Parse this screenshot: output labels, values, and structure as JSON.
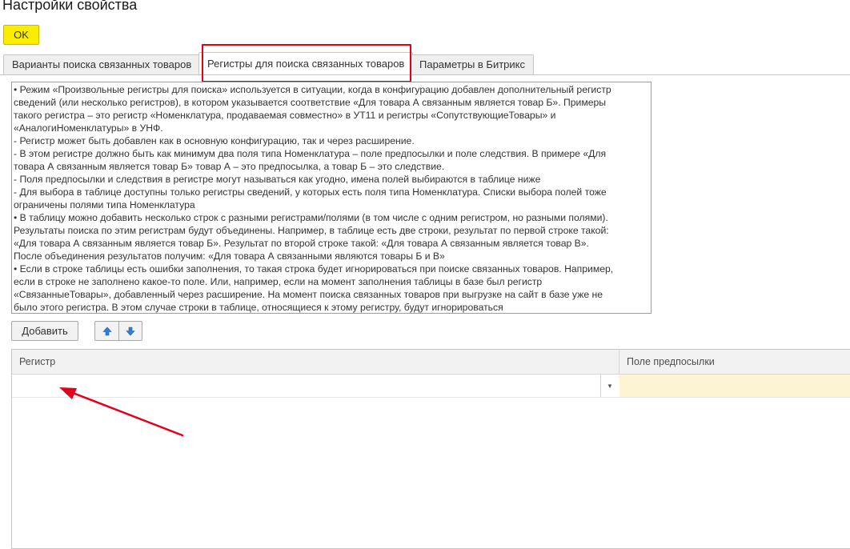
{
  "window": {
    "title": "Настройки свойства"
  },
  "toolbar": {
    "ok_label": "OK"
  },
  "tabs": [
    {
      "label": "Варианты поиска связанных товаров",
      "active": false
    },
    {
      "label": "Регистры для поиска связанных товаров",
      "active": true
    },
    {
      "label": "Параметры в Битрикс",
      "active": false
    }
  ],
  "info": {
    "lines": [
      "• Режим «Произвольные регистры для поиска» используется в ситуации, когда в конфигурацию добавлен дополнительный регистр",
      "сведений (или несколько регистров), в котором указывается соответствие «Для товара А связанным является товар Б». Примеры",
      "такого регистра – это регистр «Номенклатура, продаваемая совместно» в УТ11 и регистры «СопутствующиеТовары» и",
      "«АналогиНоменклатуры» в УНФ.",
      "- Регистр может быть добавлен как в основную конфигурацию, так и через расширение.",
      "- В этом регистре должно быть как минимум два поля типа Номенклатура – поле предпосылки и поле следствия. В примере «Для",
      "товара А связанным является товар Б» товар А – это предпосылка, а товар Б – это следствие.",
      "- Поля предпосылки и следствия в регистре могут называться как угодно, имена полей выбираются в таблице ниже",
      "- Для выбора в таблице доступны только регистры сведений, у которых есть поля типа Номенклатура. Списки выбора полей тоже",
      "ограничены полями типа Номенклатура",
      "• В таблицу можно добавить несколько строк с разными регистрами/полями (в том числе с одним регистром, но разными полями).",
      "Результаты поиска по этим регистрам будут объединены. Например, в таблице есть две строки, результат по первой строке такой:",
      "«Для товара А связанным является товар Б». Результат по второй строке такой: «Для товара А связанным является товар В».",
      "После объединения результатов получим: «Для товара А связанными являются товары Б и В»",
      "• Если в строке таблицы есть ошибки заполнения, то такая строка будет игнорироваться при поиске связанных товаров. Например,",
      "если в строке не заполнено какое-то поле. Или, например, если на момент заполнения таблицы в базе был регистр",
      "«СвязанныеТовары», добавленный через расширение. На момент поиска связанных товаров при выгрузке на сайт в базе уже не",
      "было этого регистра. В этом случае строки в таблице, относящиеся к этому регистру, будут игнорироваться"
    ]
  },
  "table_toolbar": {
    "add_label": "Добавить",
    "move_up_icon": "arrow-up-icon",
    "move_down_icon": "arrow-down-icon"
  },
  "table": {
    "columns": [
      "Регистр",
      "Поле предпосылки"
    ],
    "rows": [
      {
        "register": "",
        "premise_field": ""
      }
    ]
  },
  "colors": {
    "ok_button": "#fbed00",
    "highlight": "#e3001b",
    "arrow_icon": "#2e7fd6",
    "premise_cell": "#fcf4d2"
  }
}
